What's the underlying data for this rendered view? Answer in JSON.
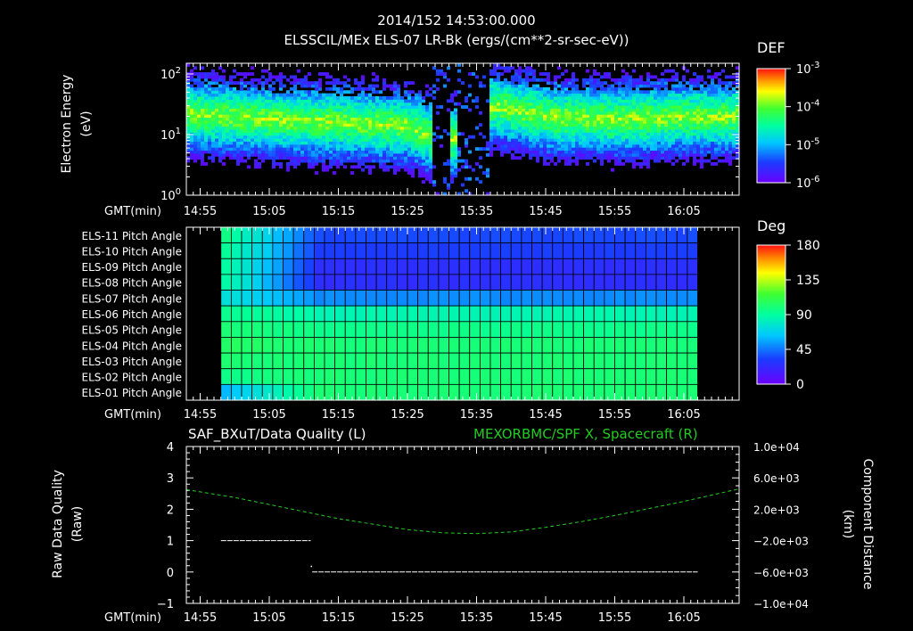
{
  "header": {
    "time": "2014/152 14:53:00.000",
    "subtitle": "ELSSCIL/MEx ELS-07 LR-Bk  (ergs/(cm**2-sr-sec-eV))"
  },
  "x_axis": {
    "label": "GMT(min)",
    "ticks": [
      "14:55",
      "15:05",
      "15:15",
      "15:25",
      "15:35",
      "15:45",
      "15:55",
      "16:05"
    ],
    "tick_minutes": [
      895,
      905,
      915,
      925,
      935,
      945,
      955,
      965
    ],
    "range_minutes": [
      893,
      973
    ]
  },
  "colors": {
    "frame": "#ffffff",
    "text": "#ffffff",
    "dashed_green": "#22cc22"
  },
  "chart_data": [
    {
      "type": "heatmap",
      "name": "spectrogram",
      "ylabel_line1": "Electron Energy",
      "ylabel_line2": "(eV)",
      "y_scale": "log",
      "ylim": [
        1,
        150
      ],
      "y_ticks": [
        {
          "base": "10",
          "exp": "0",
          "value": 1
        },
        {
          "base": "10",
          "exp": "1",
          "value": 10
        },
        {
          "base": "10",
          "exp": "2",
          "value": 100
        }
      ],
      "colorbar": {
        "title": "DEF",
        "scale": "log",
        "range": [
          1e-06,
          0.001
        ],
        "ticks": [
          {
            "base": "10",
            "exp": "-3",
            "value": 0.001
          },
          {
            "base": "10",
            "exp": "-4",
            "value": 0.0001
          },
          {
            "base": "10",
            "exp": "-5",
            "value": 1e-05
          },
          {
            "base": "10",
            "exp": "-6",
            "value": 1e-06
          }
        ]
      },
      "band": {
        "center_energy_ev_by_minute": [
          [
            893,
            22
          ],
          [
            905,
            18
          ],
          [
            915,
            16
          ],
          [
            925,
            14
          ],
          [
            928,
            10
          ],
          [
            931,
            8
          ],
          [
            937,
            30
          ],
          [
            945,
            20
          ],
          [
            955,
            18
          ],
          [
            965,
            20
          ],
          [
            973,
            20
          ]
        ],
        "data_gaps_minutes": [
          [
            928.5,
            931
          ],
          [
            932,
            936.5
          ]
        ]
      }
    },
    {
      "type": "heatmap",
      "name": "pitch-angle",
      "rows": [
        "ELS-11 Pitch Angle",
        "ELS-10 Pitch Angle",
        "ELS-09 Pitch Angle",
        "ELS-08 Pitch Angle",
        "ELS-07 Pitch Angle",
        "ELS-06 Pitch Angle",
        "ELS-05 Pitch Angle",
        "ELS-04 Pitch Angle",
        "ELS-03 Pitch Angle",
        "ELS-02 Pitch Angle",
        "ELS-01 Pitch Angle"
      ],
      "time_range_minutes": [
        898,
        967
      ],
      "row_values_deg_early": [
        95,
        92,
        90,
        88,
        75,
        95,
        100,
        105,
        100,
        95,
        60
      ],
      "row_values_deg_late": [
        35,
        32,
        25,
        25,
        50,
        85,
        95,
        100,
        100,
        100,
        100
      ],
      "colorbar": {
        "title": "Deg",
        "range": [
          0,
          180
        ],
        "ticks": [
          "180",
          "135",
          "90",
          "45",
          "0"
        ]
      }
    },
    {
      "type": "line",
      "name": "quality-and-position",
      "title_left": "SAF_BXuT/Data Quality (L)",
      "title_right": "MEXORBMC/SPF X, Spacecraft (R)",
      "ylabel_left_line1": "Raw Data Quality",
      "ylabel_left_line2": "(Raw)",
      "ylabel_right_line1": "Component Distance",
      "ylabel_right_line2": "(km)",
      "ylim_left": [
        -1,
        4
      ],
      "y_ticks_left": [
        "4",
        "3",
        "2",
        "1",
        "0",
        "−1"
      ],
      "ylim_right": [
        -10000,
        10000
      ],
      "y_ticks_right": [
        "1.0e+04",
        "6.0e+03",
        "2.0e+03",
        "−2.0e+03",
        "−6.0e+03",
        "−1.0e+04"
      ],
      "series": [
        {
          "axis": "left",
          "x": [
            898,
            911
          ],
          "y": [
            1,
            1
          ]
        },
        {
          "axis": "left",
          "x": [
            911.2,
            967
          ],
          "y": [
            0,
            0
          ]
        },
        {
          "axis": "right",
          "style": "dashed",
          "x": [
            893,
            900,
            905,
            910,
            915,
            920,
            925,
            930,
            935,
            940,
            945,
            950,
            955,
            960,
            965,
            970,
            973
          ],
          "y": [
            4500,
            3500,
            2600,
            1700,
            800,
            100,
            -600,
            -1000,
            -1100,
            -900,
            -300,
            400,
            1200,
            2100,
            3000,
            4000,
            4600
          ]
        }
      ]
    }
  ]
}
